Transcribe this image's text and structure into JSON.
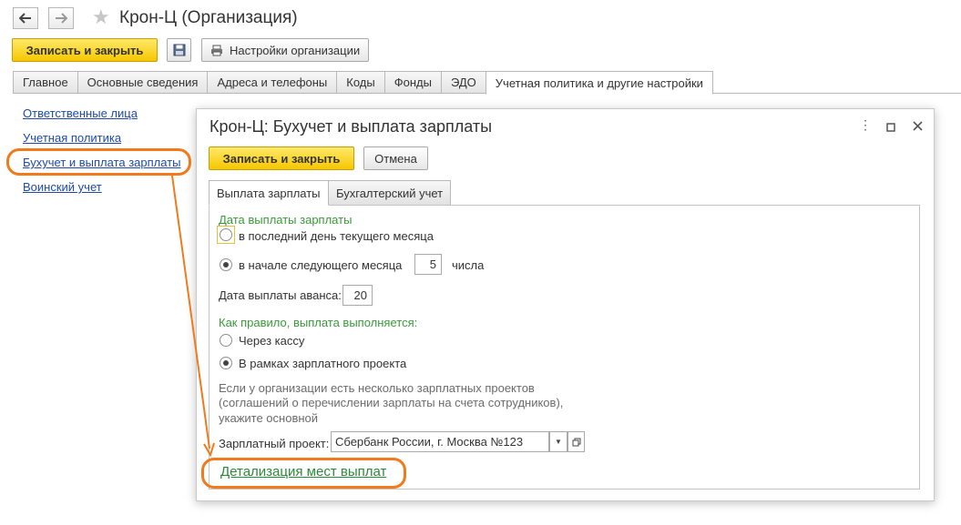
{
  "header": {
    "title": "Крон-Ц (Организация)",
    "back_icon": "arrow-left-icon",
    "forward_icon": "arrow-right-icon",
    "favorite_icon": "star-icon"
  },
  "toolbar": {
    "save_close_label": "Записать и закрыть",
    "save_icon": "floppy-disk-icon",
    "settings_label": "Настройки организации",
    "settings_icon": "printer-icon"
  },
  "tabs": [
    {
      "label": "Главное"
    },
    {
      "label": "Основные сведения"
    },
    {
      "label": "Адреса и телефоны"
    },
    {
      "label": "Коды"
    },
    {
      "label": "Фонды"
    },
    {
      "label": "ЭДО"
    },
    {
      "label": "Учетная политика и другие настройки"
    }
  ],
  "sidebar": {
    "items": [
      {
        "label": "Ответственные лица"
      },
      {
        "label": "Учетная политика"
      },
      {
        "label": "Бухучет и выплата зарплаты"
      },
      {
        "label": "Воинский учет"
      }
    ]
  },
  "dialog": {
    "title": "Крон-Ц: Бухучет и выплата зарплаты",
    "save_close_label": "Записать и закрыть",
    "cancel_label": "Отмена",
    "tabs": [
      {
        "label": "Выплата зарплаты"
      },
      {
        "label": "Бухгалтерский учет"
      }
    ],
    "pay_date_header": "Дата выплаты зарплаты",
    "radio_last_day": "в последний день текущего месяца",
    "radio_next_month": "в начале следующего месяца",
    "next_month_day": "5",
    "day_suffix": "числа",
    "advance_label": "Дата выплаты аванса:",
    "advance_value": "20",
    "payment_header": "Как правило, выплата выполняется:",
    "radio_cash": "Через кассу",
    "radio_project": "В рамках зарплатного проекта",
    "hint_line1": "Если у организации есть несколько зарплатных проектов",
    "hint_line2": "(соглашений о перечислении зарплаты на счета сотрудников),",
    "hint_line3": "укажите основной",
    "project_label": "Зарплатный проект:",
    "project_value": "Сбербанк России, г. Москва №123",
    "details_link": "Детализация мест выплат"
  },
  "colors": {
    "accent_yellow": "#f6c700",
    "highlight_orange": "#f07a1c",
    "link_blue": "#1f4aa8",
    "section_green": "#3a9a3a"
  }
}
